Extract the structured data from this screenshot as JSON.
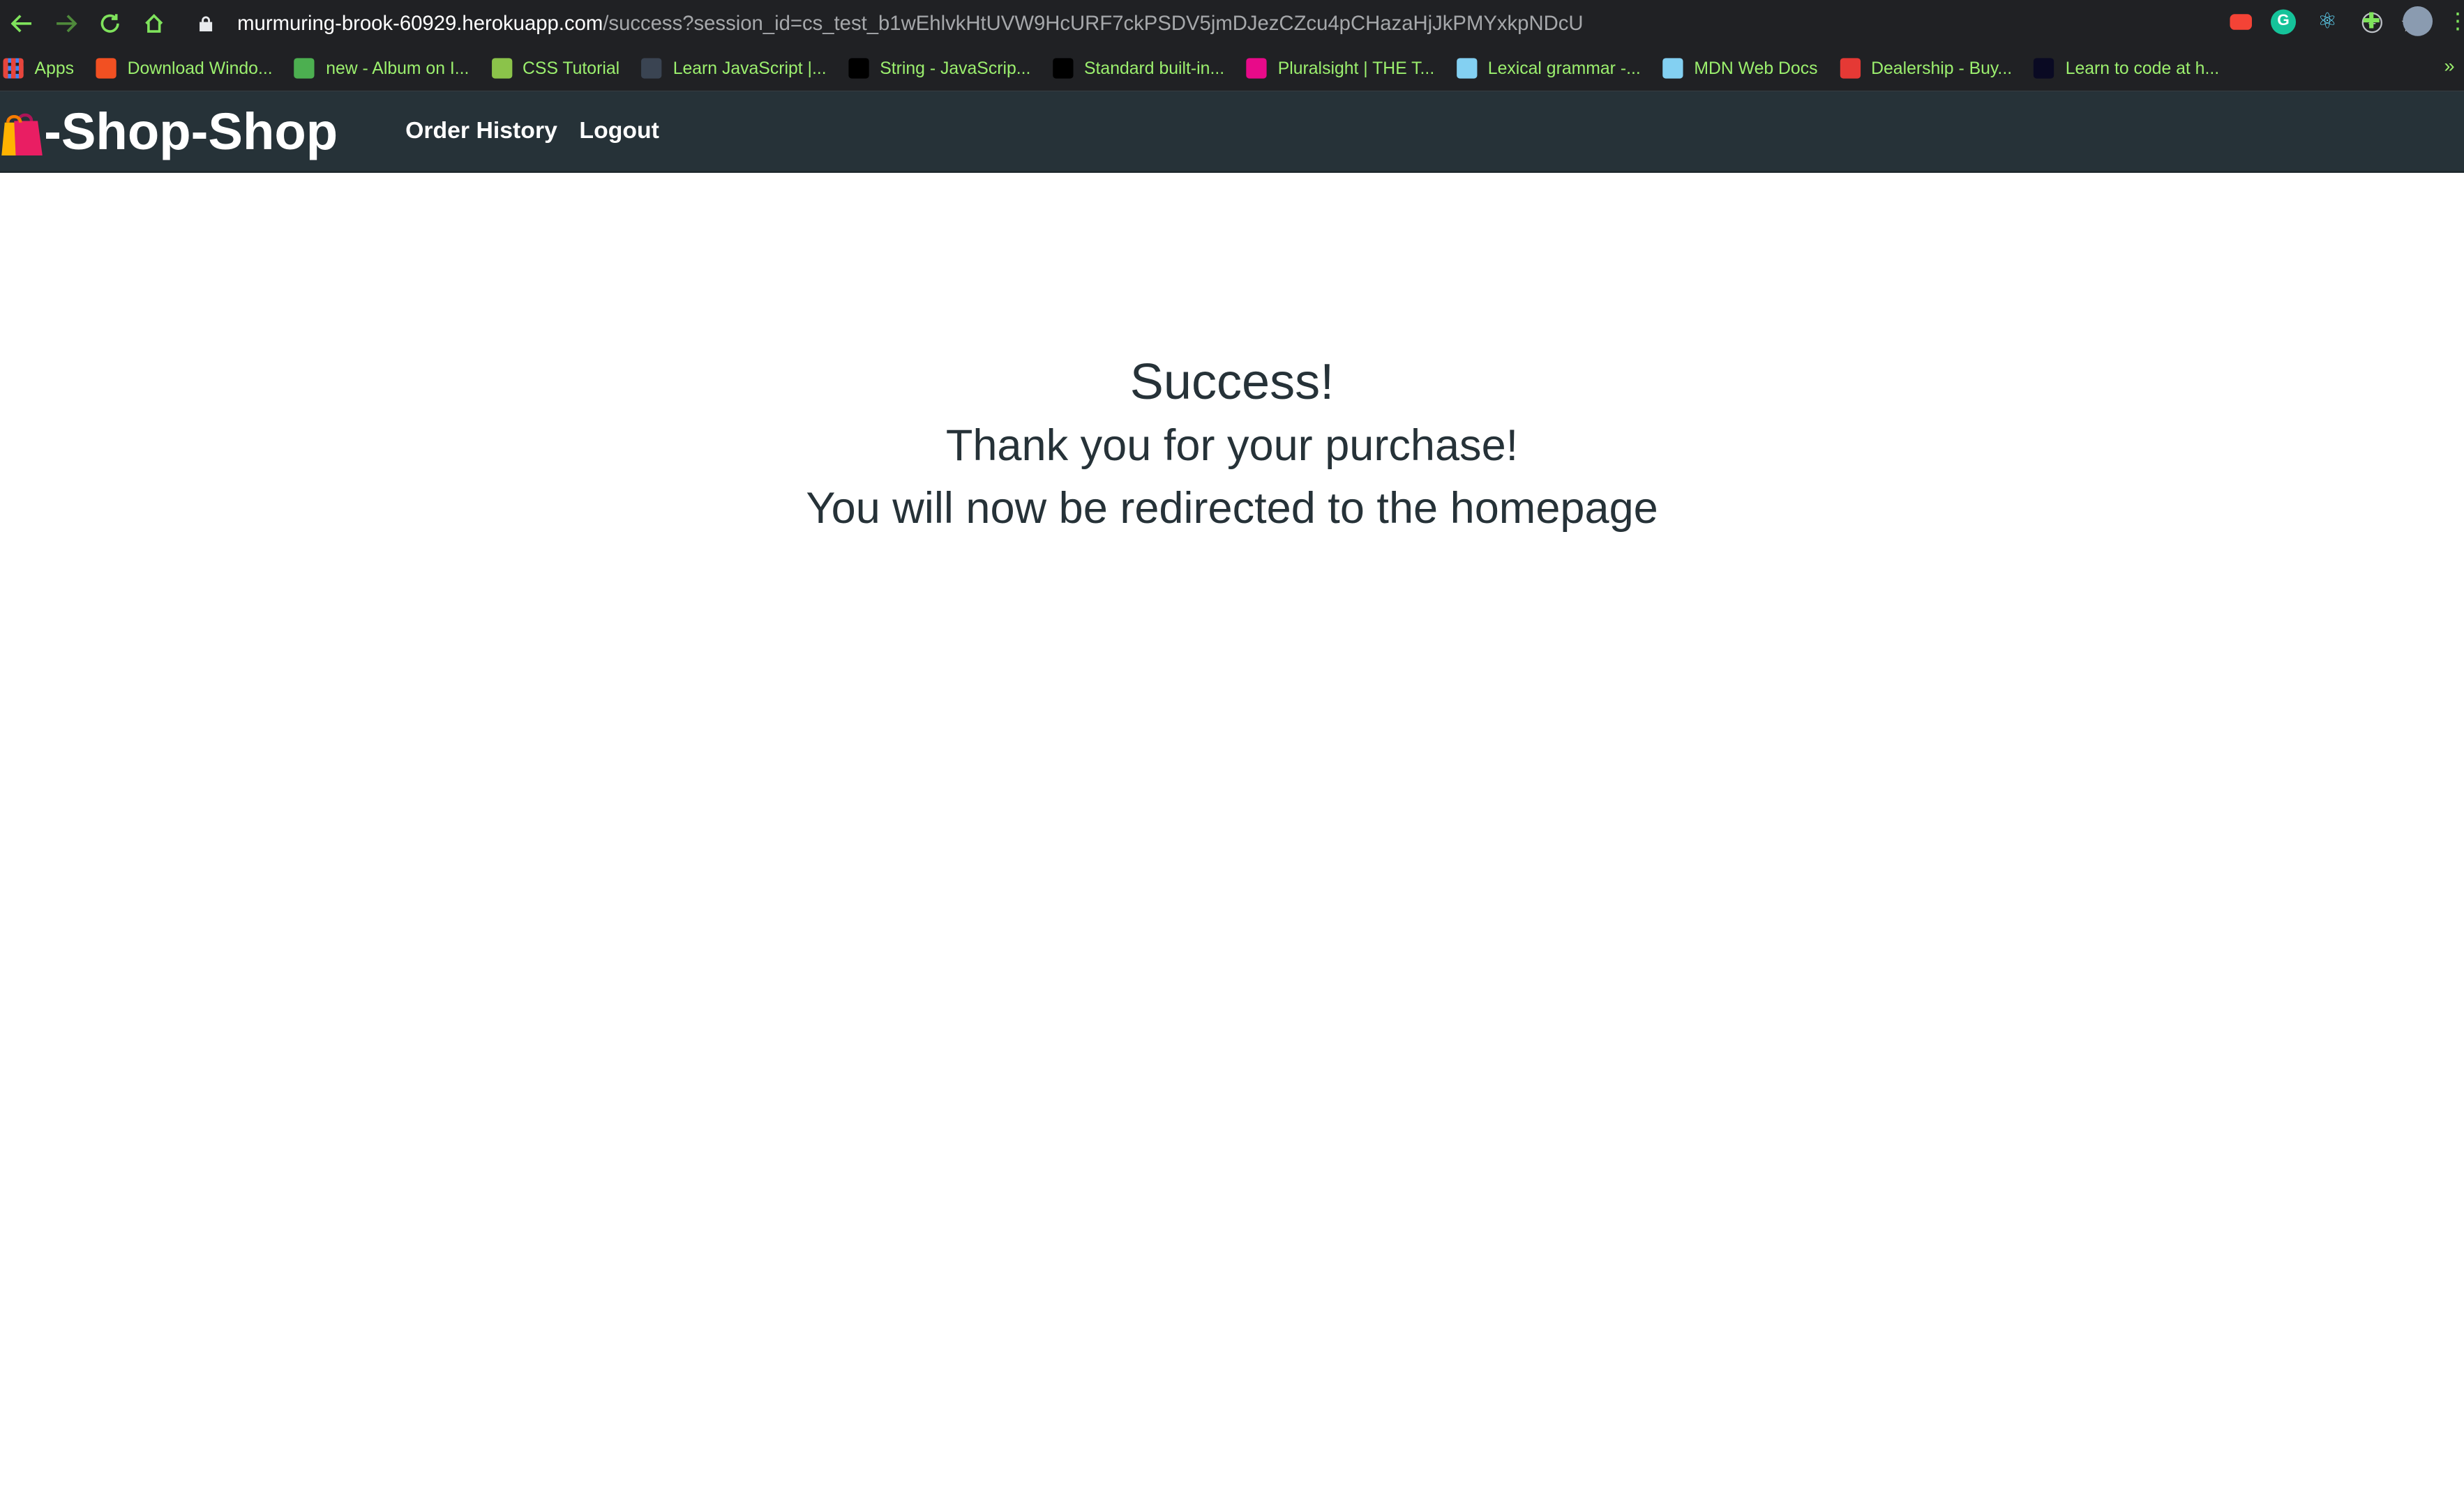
{
  "browser": {
    "url_host": "murmuring-brook-60929.herokuapp.com",
    "url_path": "/success?session_id=cs_test_b1wEhlvkHtUVW9HcURF7ckPSDV5jmDJezCZcu4pCHazaHjJkPMYxkpNDcU",
    "bookmarks": [
      {
        "label": "Apps",
        "icon": "apps-grid-icon",
        "color": "#e8453c"
      },
      {
        "label": "Download Windo...",
        "icon": "windows-icon",
        "color": "#f25022"
      },
      {
        "label": "new - Album on I...",
        "icon": "album-icon",
        "color": "#4caf50"
      },
      {
        "label": "CSS Tutorial",
        "icon": "w3-icon",
        "color": "#8bc34a"
      },
      {
        "label": "Learn JavaScript |...",
        "icon": "js-icon",
        "color": "#3a4452"
      },
      {
        "label": "String - JavaScrip...",
        "icon": "mdn-icon",
        "color": "#000000"
      },
      {
        "label": "Standard built-in...",
        "icon": "mdn-icon",
        "color": "#000000"
      },
      {
        "label": "Pluralsight | THE T...",
        "icon": "pluralsight-icon",
        "color": "#e80a89"
      },
      {
        "label": "Lexical grammar -...",
        "icon": "mdn-icon",
        "color": "#83d0f2"
      },
      {
        "label": "MDN Web Docs",
        "icon": "mdn-icon",
        "color": "#83d0f2"
      },
      {
        "label": "Dealership - Buy...",
        "icon": "n-icon",
        "color": "#e53935"
      },
      {
        "label": "Learn to code at h...",
        "icon": "freecodecamp-icon",
        "color": "#0a0a23"
      }
    ],
    "more_label": "»"
  },
  "app": {
    "brand": "-Shop-Shop",
    "nav": {
      "order_history": "Order History",
      "logout": "Logout"
    }
  },
  "main": {
    "title": "Success!",
    "thanks": "Thank you for your purchase!",
    "redirect": "You will now be redirected to the homepage"
  },
  "colors": {
    "header_bg": "#263238",
    "text": "#263238",
    "chrome_bg": "#202124",
    "bookmark_text": "#9cf06e"
  }
}
